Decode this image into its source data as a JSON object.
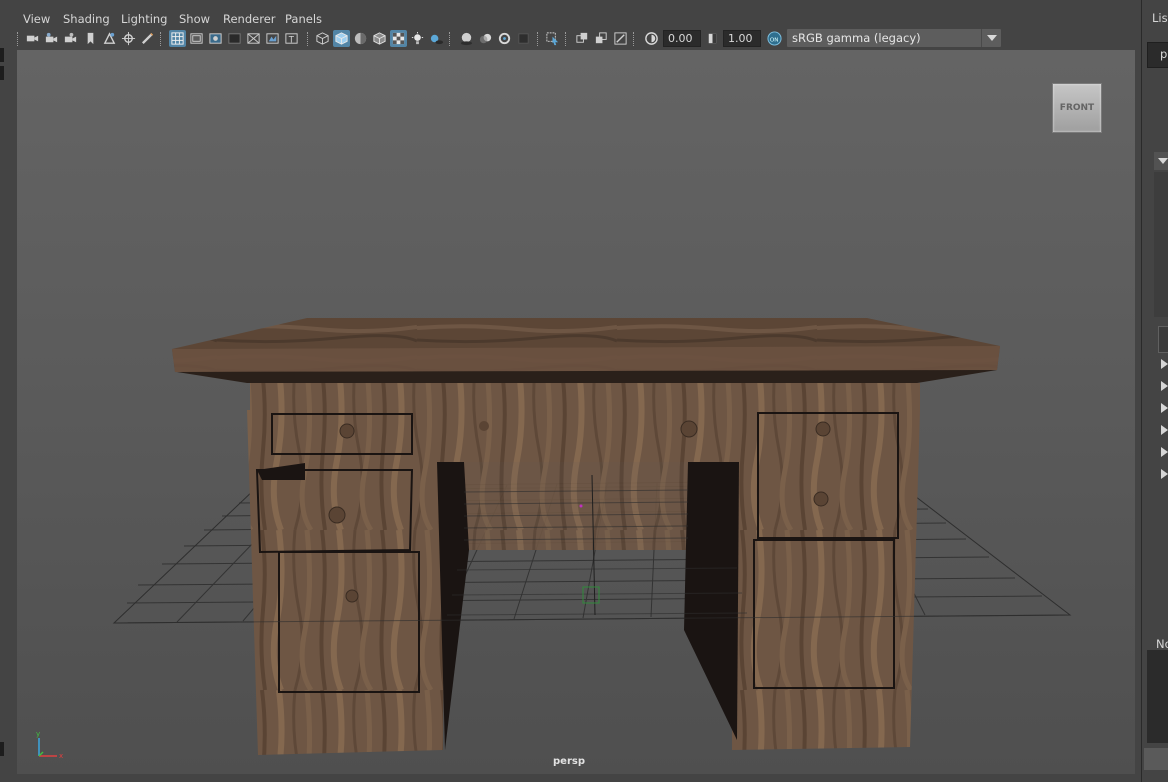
{
  "menu": {
    "view": "View",
    "shading": "Shading",
    "lighting": "Lighting",
    "show": "Show",
    "renderer": "Renderer",
    "panels": "Panels"
  },
  "toolbar": {
    "exposure_value": "0.00",
    "gamma_value": "1.00",
    "color_management_label": "sRGB gamma (legacy)",
    "accent_color": "#5285a6"
  },
  "viewport": {
    "camera_name": "persp",
    "viewcube_face": "FRONT"
  },
  "right_panel": {
    "header": "List",
    "tab": "p",
    "notes_label": "No"
  }
}
